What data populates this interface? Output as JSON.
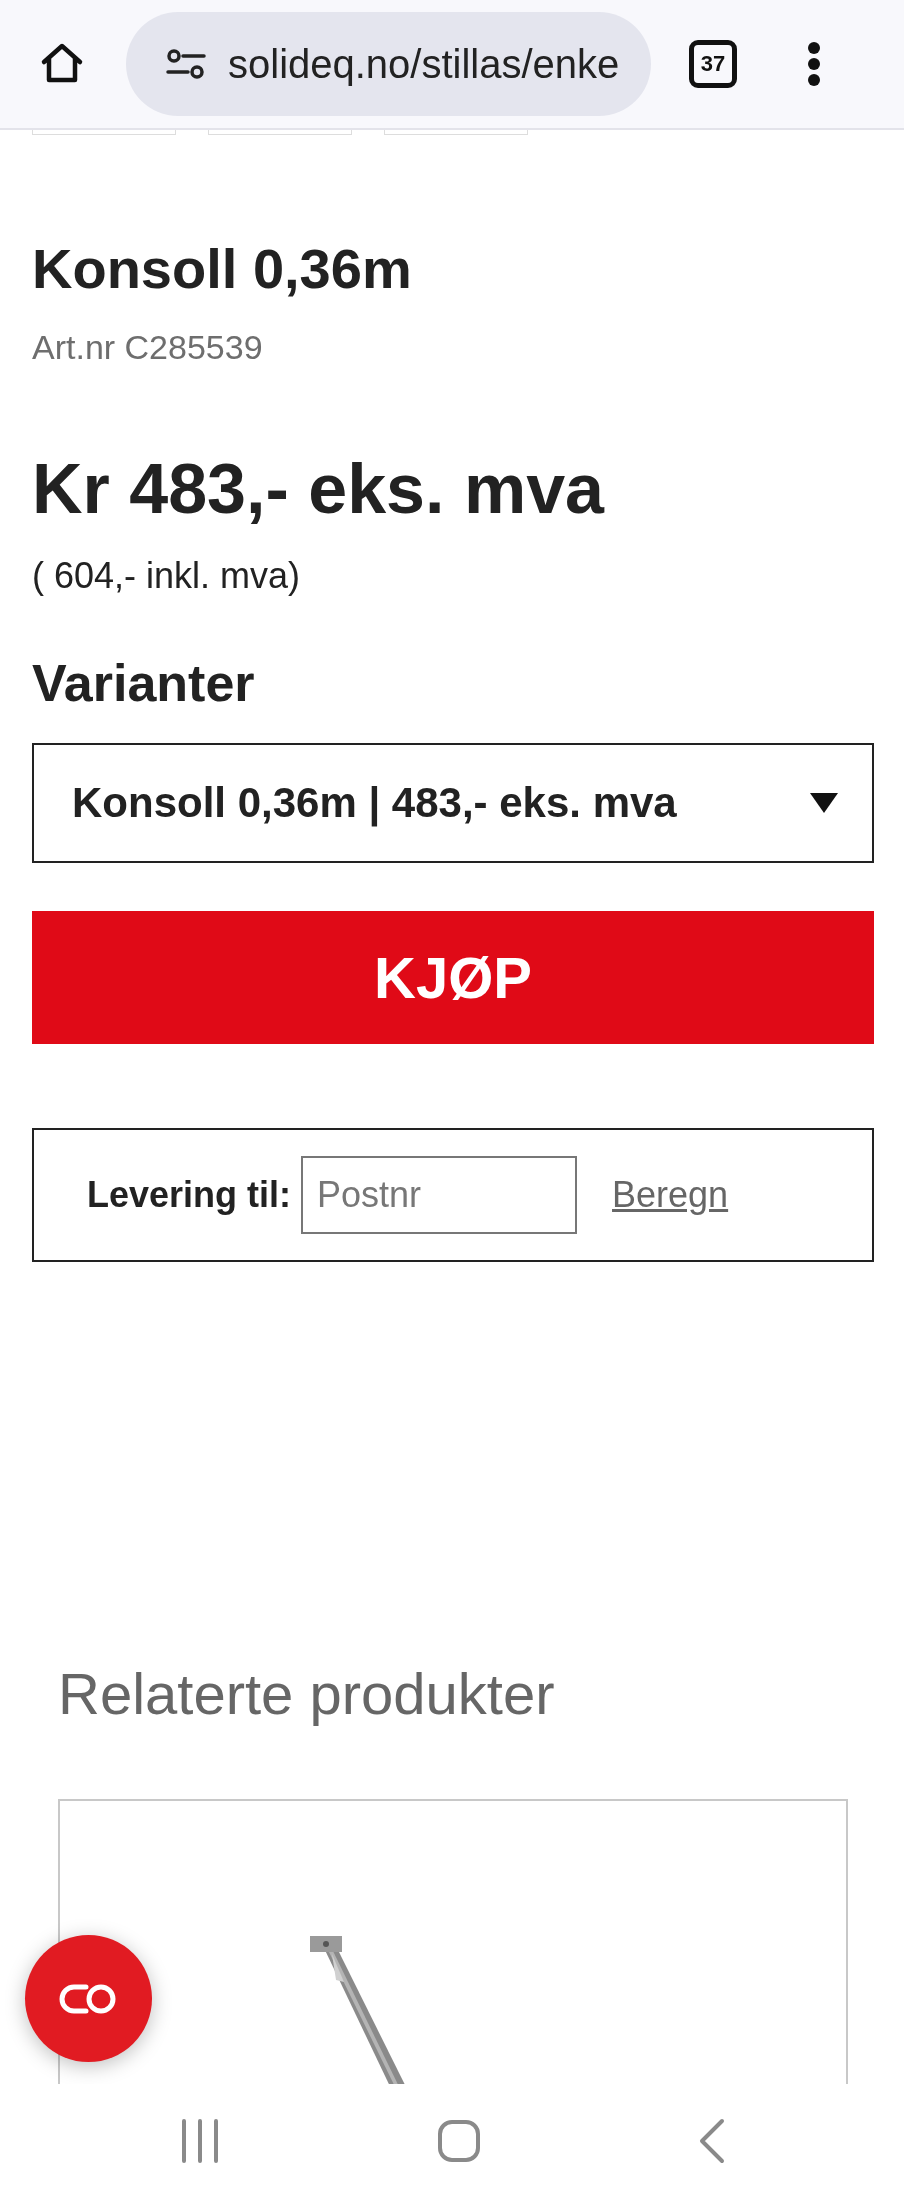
{
  "browser": {
    "url": "solideq.no/stillas/enke",
    "tab_count": "37"
  },
  "product": {
    "title": "Konsoll 0,36m",
    "article": "Art.nr C285539",
    "price": "Kr 483,- eks. mva",
    "price_incl": "( 604,- inkl. mva)"
  },
  "variants": {
    "label": "Varianter",
    "selected_value": "Konsoll 0,36m | 483,- eks. mva"
  },
  "buy_button": "KJØP",
  "delivery": {
    "label": "Levering til:",
    "placeholder": "Postnr",
    "link": "Beregn"
  },
  "related": {
    "heading": "Relaterte produkter"
  }
}
